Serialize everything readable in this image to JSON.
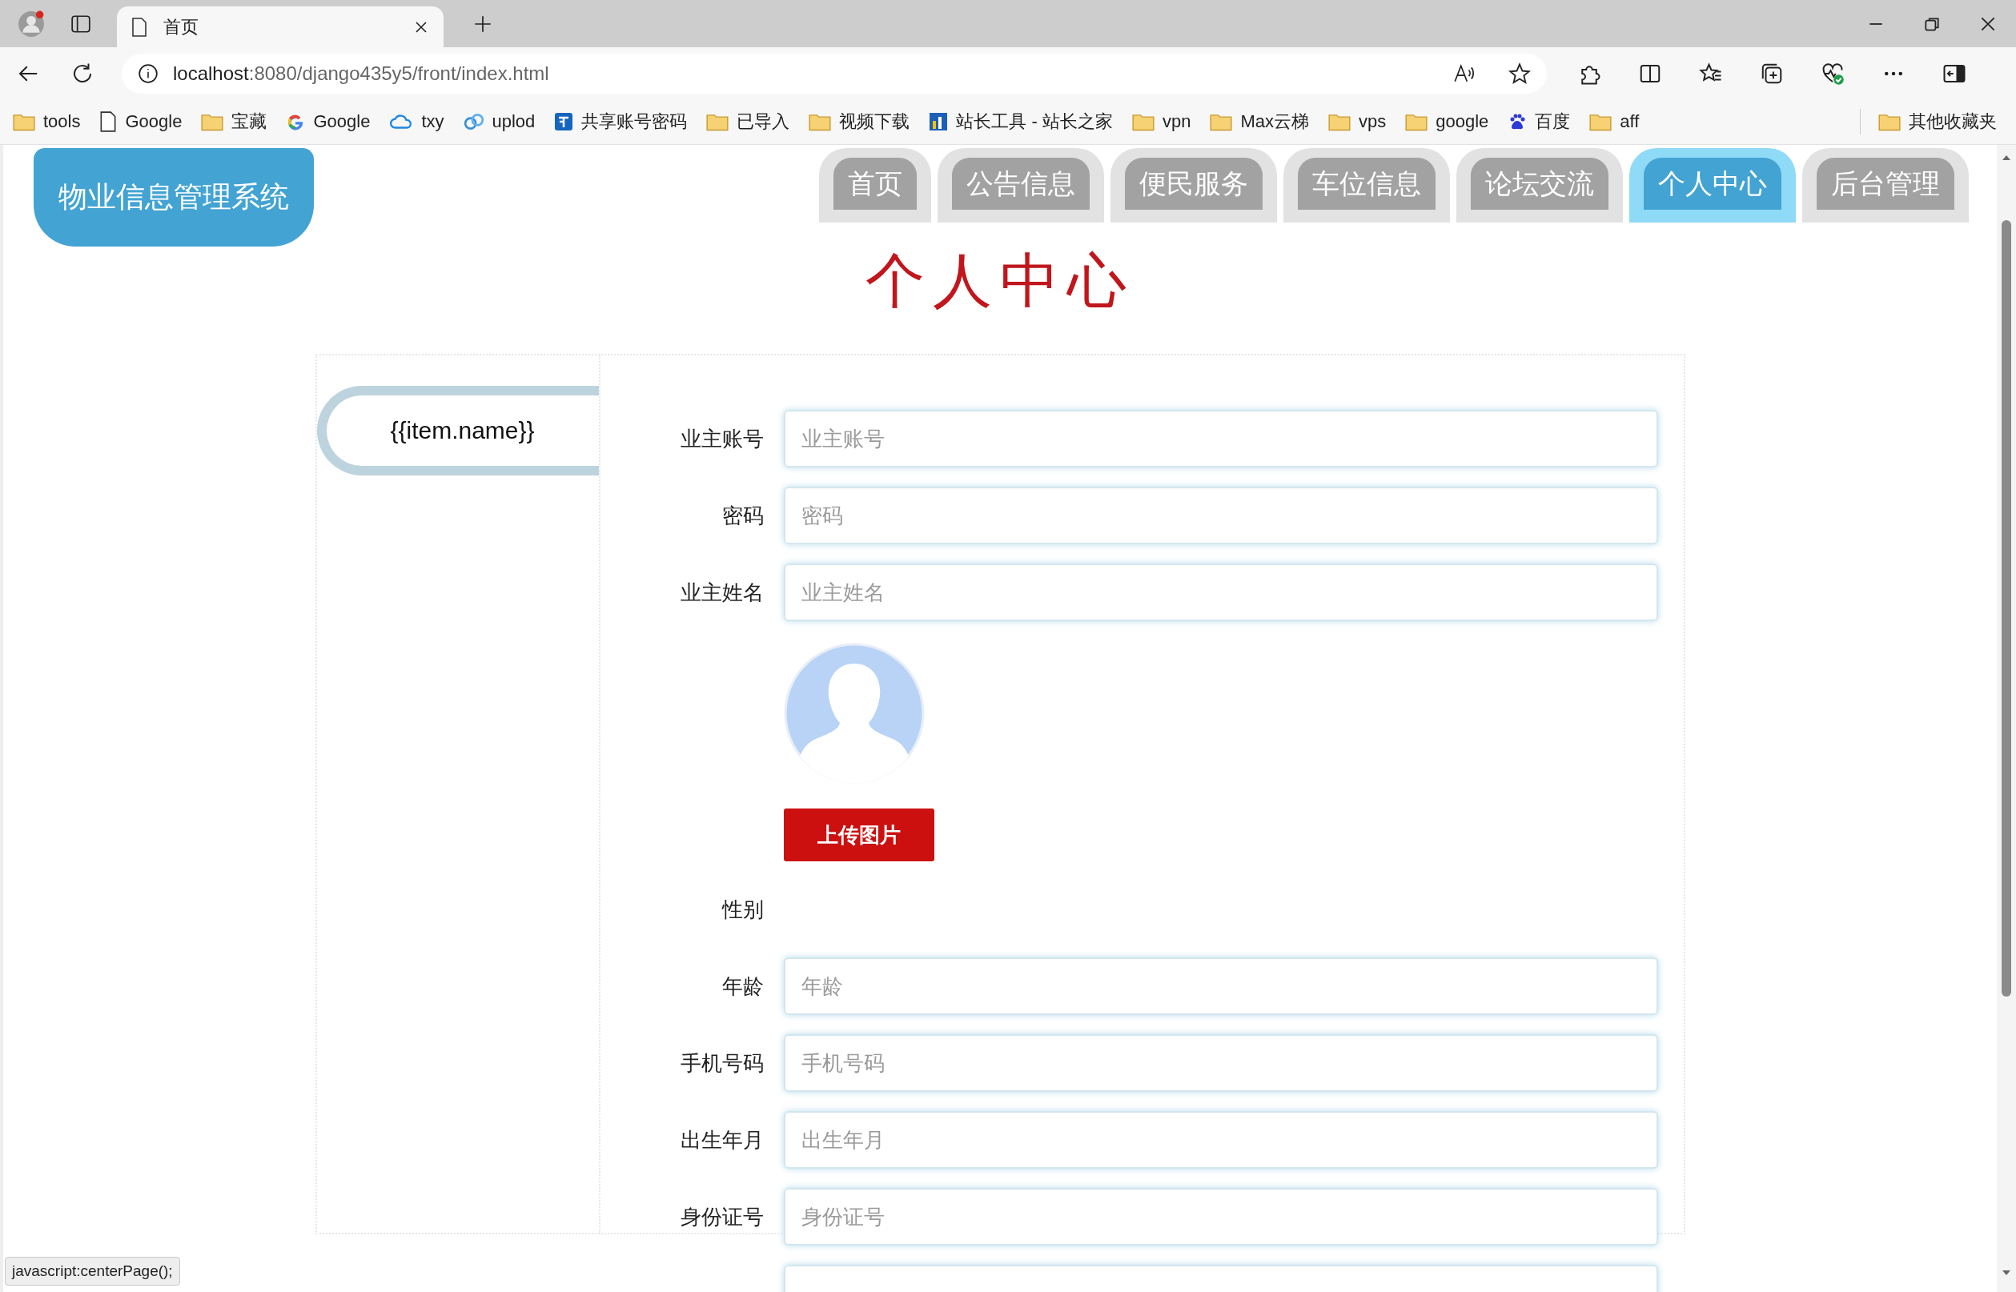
{
  "browser": {
    "tabs": [
      {
        "title": "首页",
        "selected": true
      }
    ],
    "url": {
      "host": "localhost",
      "path": ":8080/django435y5/front/index.html"
    },
    "bookmarks": [
      {
        "kind": "folder",
        "label": "tools"
      },
      {
        "kind": "page",
        "label": "Google"
      },
      {
        "kind": "folder",
        "label": "宝藏"
      },
      {
        "kind": "g-logo",
        "label": "Google"
      },
      {
        "kind": "cloud",
        "label": "txy"
      },
      {
        "kind": "swirl",
        "label": "uplod"
      },
      {
        "kind": "app",
        "label": "共享账号密码"
      },
      {
        "kind": "folder",
        "label": "已导入"
      },
      {
        "kind": "folder",
        "label": "视频下载"
      },
      {
        "kind": "site",
        "label": "站长工具 - 站长之家"
      },
      {
        "kind": "folder",
        "label": "vpn"
      },
      {
        "kind": "folder",
        "label": "Max云梯"
      },
      {
        "kind": "folder",
        "label": "vps"
      },
      {
        "kind": "folder",
        "label": "google"
      },
      {
        "kind": "paw",
        "label": "百度"
      },
      {
        "kind": "folder",
        "label": "aff"
      }
    ],
    "other_bookmarks": {
      "kind": "folder",
      "label": "其他收藏夹"
    }
  },
  "page": {
    "logo": "物业信息管理系统",
    "nav": [
      {
        "label": "首页",
        "selected": false
      },
      {
        "label": "公告信息",
        "selected": false
      },
      {
        "label": "便民服务",
        "selected": false
      },
      {
        "label": "车位信息",
        "selected": false
      },
      {
        "label": "论坛交流",
        "selected": false
      },
      {
        "label": "个人中心",
        "selected": true
      },
      {
        "label": "后台管理",
        "selected": false
      }
    ],
    "heading": "个人中心",
    "sidebar": {
      "items": [
        {
          "label": "{{item.name}}"
        }
      ]
    },
    "form": {
      "fields": [
        {
          "kind": "input",
          "label": "业主账号",
          "placeholder": "业主账号"
        },
        {
          "kind": "input",
          "label": "密码",
          "placeholder": "密码"
        },
        {
          "kind": "input",
          "label": "业主姓名",
          "placeholder": "业主姓名"
        },
        {
          "kind": "avatar",
          "button": "上传图片"
        },
        {
          "kind": "label",
          "label": "性别"
        },
        {
          "kind": "input",
          "label": "年龄",
          "placeholder": "年龄"
        },
        {
          "kind": "input",
          "label": "手机号码",
          "placeholder": "手机号码"
        },
        {
          "kind": "input",
          "label": "出生年月",
          "placeholder": "出生年月"
        },
        {
          "kind": "input",
          "label": "身份证号",
          "placeholder": "身份证号"
        },
        {
          "kind": "input"
        }
      ]
    }
  },
  "status_bar": "javascript:centerPage();"
}
